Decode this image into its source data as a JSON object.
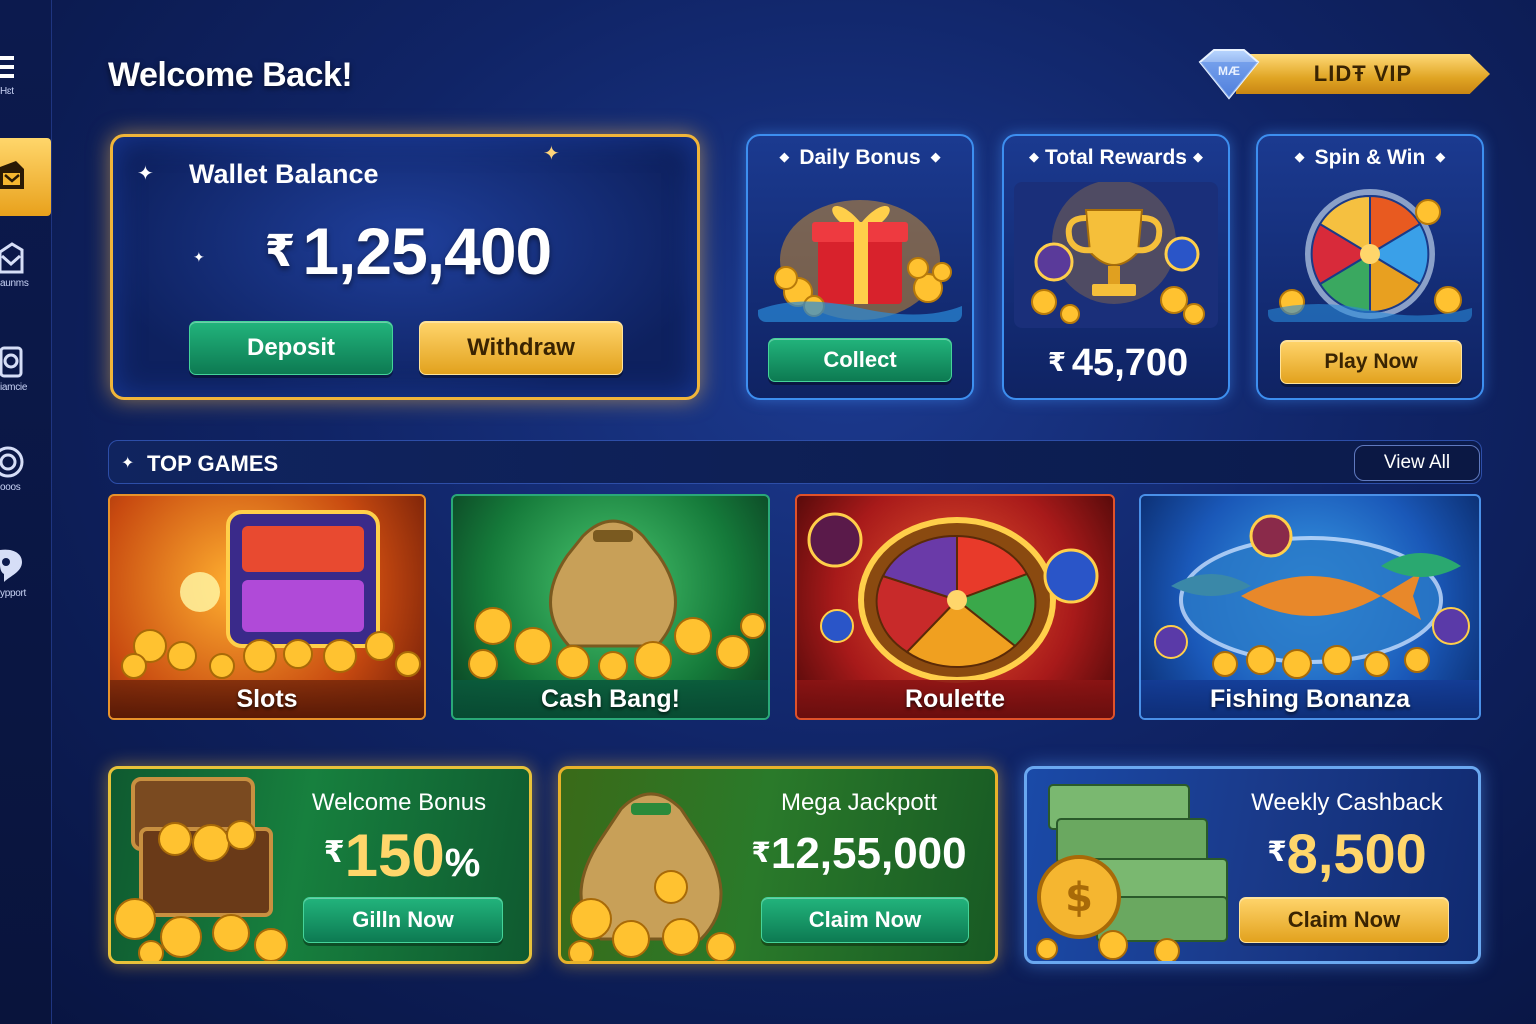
{
  "sidebar": {
    "items": [
      {
        "label": "Hɛt"
      },
      {
        "label": ""
      },
      {
        "label": "aunms"
      },
      {
        "label": "iamcie"
      },
      {
        "label": "ooos"
      },
      {
        "label": "ypport"
      }
    ]
  },
  "header": {
    "welcome": "Welcome Back!",
    "vip_badge": "LIDŦ VIP",
    "vip_gem_text": "MÆ"
  },
  "wallet": {
    "title": "Wallet Balance",
    "currency": "₹",
    "amount": "1,25,400",
    "deposit_label": "Deposit",
    "withdraw_label": "Withdraw"
  },
  "cards": {
    "daily_bonus": {
      "title": "Daily Bonus",
      "button": "Collect"
    },
    "total_rewards": {
      "title": "Total Rewards",
      "currency": "₹",
      "amount": "45,700"
    },
    "spin_win": {
      "title": "Spin & Win",
      "button": "Play Now"
    }
  },
  "top_games": {
    "title": "TOP GAMES",
    "view_all": "View All",
    "games": [
      {
        "label": "Slots"
      },
      {
        "label": "Cash Bang!"
      },
      {
        "label": "Roulette"
      },
      {
        "label": "Fishing Bonanza"
      }
    ]
  },
  "promos": [
    {
      "title": "Welcome Bonus",
      "currency": "₹",
      "amount": "150",
      "suffix": "%",
      "button": "Gilln Now"
    },
    {
      "title": "Mega Jackpott",
      "currency": "₹",
      "amount": "12,55,000",
      "button": "Claim Now"
    },
    {
      "title": "Weekly Cashback",
      "currency": "₹",
      "amount": "8,500",
      "button": "Claim Now"
    }
  ],
  "colors": {
    "accent_gold": "#f0b53a",
    "accent_green": "#1a9e6c",
    "accent_blue": "#3d8ff0",
    "background": "#102466"
  }
}
